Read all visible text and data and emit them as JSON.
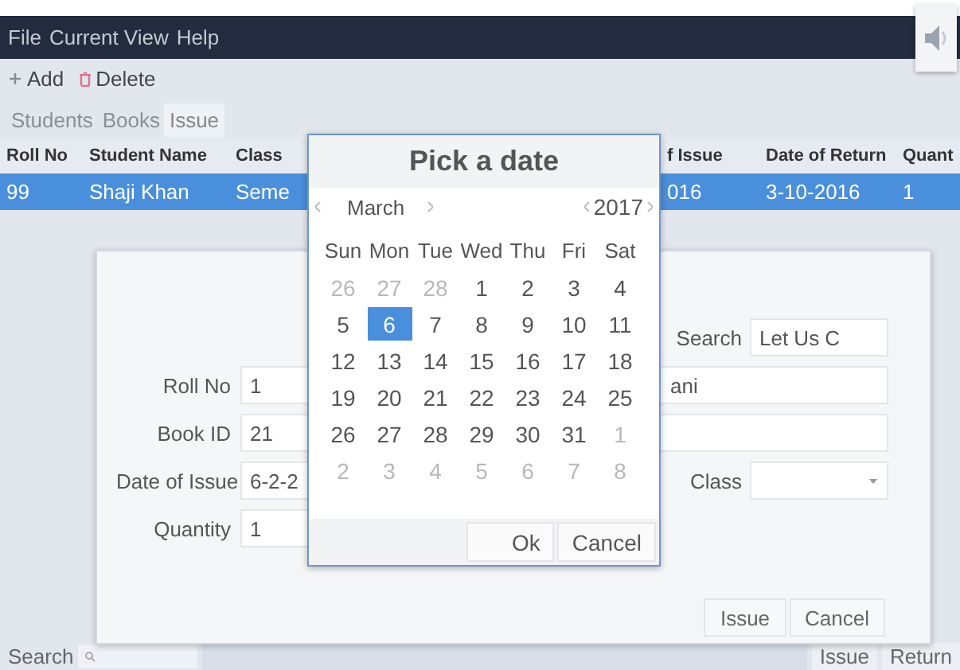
{
  "menu": [
    {
      "label": "File"
    },
    {
      "label": "Current View"
    },
    {
      "label": "Help"
    }
  ],
  "toolbar": [
    {
      "label": "Add",
      "kind": "add"
    },
    {
      "label": "Delete",
      "kind": "delete"
    }
  ],
  "tabs": [
    {
      "label": "Students",
      "selected": false
    },
    {
      "label": "Books",
      "selected": false
    },
    {
      "label": "Issue",
      "selected": true
    }
  ],
  "table": {
    "columns": [
      "Roll No",
      "Student Name",
      "Class",
      "f Issue",
      "Date of Return",
      "Quant"
    ],
    "rows": [
      {
        "cells": [
          "99",
          "Shaji Khan",
          "Seme",
          "016",
          "3-10-2016",
          "1"
        ],
        "selected": true
      }
    ]
  },
  "issue_dialog": {
    "search": {
      "label": "Search",
      "value": "Let Us C"
    },
    "fields": [
      {
        "label": "Roll No",
        "value": "1"
      },
      {
        "label": "Book ID",
        "value": "21"
      },
      {
        "label": "Date of Issue",
        "value": "6-2-2"
      },
      {
        "label": "Quantity",
        "value": "1"
      }
    ],
    "book_name": "ani",
    "class_label": "Class",
    "buttons": [
      "Issue",
      "Cancel"
    ]
  },
  "date_picker": {
    "title": "Pick a date",
    "month": "March",
    "year": "2017",
    "weekdays": [
      "Sun",
      "Mon",
      "Tue",
      "Wed",
      "Thu",
      "Fri",
      "Sat"
    ],
    "days": [
      {
        "day": "26",
        "muted": true,
        "selected": false
      },
      {
        "day": "27",
        "muted": true,
        "selected": false
      },
      {
        "day": "28",
        "muted": true,
        "selected": false
      },
      {
        "day": "1",
        "muted": false,
        "selected": false
      },
      {
        "day": "2",
        "muted": false,
        "selected": false
      },
      {
        "day": "3",
        "muted": false,
        "selected": false
      },
      {
        "day": "4",
        "muted": false,
        "selected": false
      },
      {
        "day": "5",
        "muted": false,
        "selected": false
      },
      {
        "day": "6",
        "muted": false,
        "selected": true
      },
      {
        "day": "7",
        "muted": false,
        "selected": false
      },
      {
        "day": "8",
        "muted": false,
        "selected": false
      },
      {
        "day": "9",
        "muted": false,
        "selected": false
      },
      {
        "day": "10",
        "muted": false,
        "selected": false
      },
      {
        "day": "11",
        "muted": false,
        "selected": false
      },
      {
        "day": "12",
        "muted": false,
        "selected": false
      },
      {
        "day": "13",
        "muted": false,
        "selected": false
      },
      {
        "day": "14",
        "muted": false,
        "selected": false
      },
      {
        "day": "15",
        "muted": false,
        "selected": false
      },
      {
        "day": "16",
        "muted": false,
        "selected": false
      },
      {
        "day": "17",
        "muted": false,
        "selected": false
      },
      {
        "day": "18",
        "muted": false,
        "selected": false
      },
      {
        "day": "19",
        "muted": false,
        "selected": false
      },
      {
        "day": "20",
        "muted": false,
        "selected": false
      },
      {
        "day": "21",
        "muted": false,
        "selected": false
      },
      {
        "day": "22",
        "muted": false,
        "selected": false
      },
      {
        "day": "23",
        "muted": false,
        "selected": false
      },
      {
        "day": "24",
        "muted": false,
        "selected": false
      },
      {
        "day": "25",
        "muted": false,
        "selected": false
      },
      {
        "day": "26",
        "muted": false,
        "selected": false
      },
      {
        "day": "27",
        "muted": false,
        "selected": false
      },
      {
        "day": "28",
        "muted": false,
        "selected": false
      },
      {
        "day": "29",
        "muted": false,
        "selected": false
      },
      {
        "day": "30",
        "muted": false,
        "selected": false
      },
      {
        "day": "31",
        "muted": false,
        "selected": false
      },
      {
        "day": "1",
        "muted": true,
        "selected": false
      },
      {
        "day": "2",
        "muted": true,
        "selected": false
      },
      {
        "day": "3",
        "muted": true,
        "selected": false
      },
      {
        "day": "4",
        "muted": true,
        "selected": false
      },
      {
        "day": "5",
        "muted": true,
        "selected": false
      },
      {
        "day": "6",
        "muted": true,
        "selected": false
      },
      {
        "day": "7",
        "muted": true,
        "selected": false
      },
      {
        "day": "8",
        "muted": true,
        "selected": false
      }
    ],
    "buttons": [
      "Ok",
      "Cancel"
    ]
  },
  "bottom_bar": {
    "search_label": "Search",
    "buttons": [
      "Issue",
      "Return"
    ]
  }
}
